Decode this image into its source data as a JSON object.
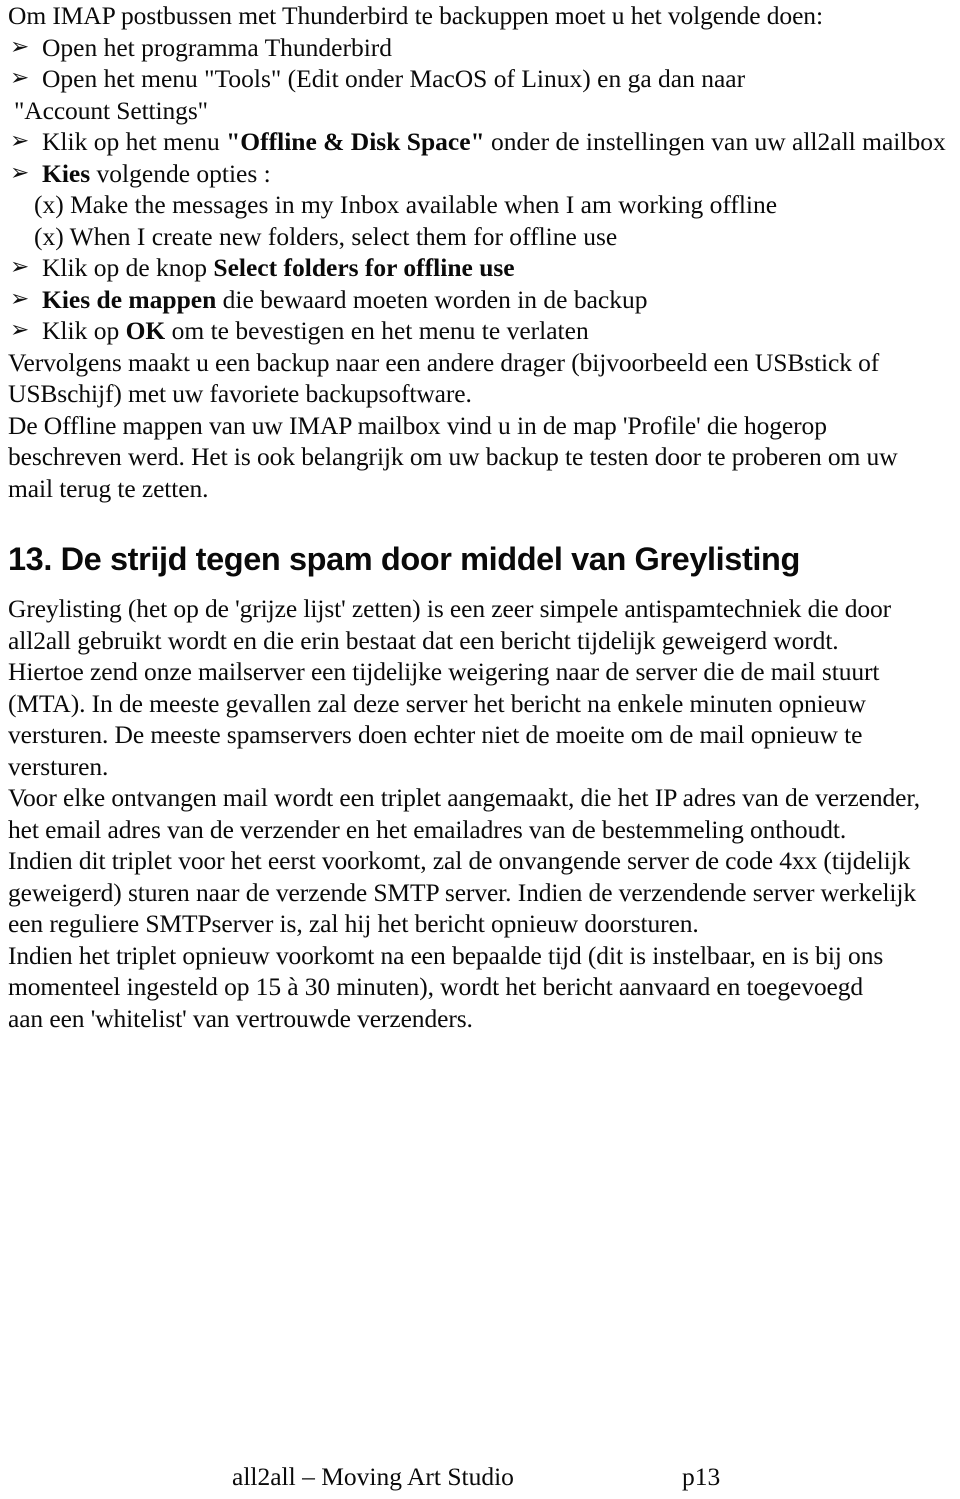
{
  "document": {
    "language": "nl",
    "page_label": "p13",
    "background_color": "#ffffff",
    "text_color": "#0a0a0a"
  },
  "intro": {
    "line": "Om IMAP postbussen met Thunderbird te backuppen moet u het volgende doen:"
  },
  "bullet_glyph": "➢",
  "steps": [
    {
      "id": "open-thunderbird",
      "text": "Open het programma Thunderbird"
    },
    {
      "id": "open-tools-menu",
      "text": "Open  het  menu  \"Tools\"  (Edit onder MacOS of Linux)  en ga dan  naar",
      "continuation": "\"Account Settings\""
    },
    {
      "id": "offline-disk-space",
      "prefix": "Klik op het menu ",
      "bold": "\"Offline & Disk Space\"",
      "suffix": " onder de instellingen van uw all2all mailbox"
    },
    {
      "id": "kies-opties",
      "bold": "Kies",
      "suffix": " volgende opties :"
    },
    {
      "id": "select-folders-button",
      "prefix": "Klik op de knop ",
      "bold": "Select folders for offline use"
    },
    {
      "id": "kies-de-mappen",
      "bold": "Kies de mappen",
      "suffix": " die bewaard moeten worden in de backup"
    },
    {
      "id": "klik-ok",
      "prefix": "Klik op ",
      "bold": "OK",
      "suffix": " om te bevestigen en het menu te verlaten"
    }
  ],
  "checkbox_options": [
    "(x) Make the messages in my Inbox available when I am working offline",
    "(x) When I create new folders, select them for offline use"
  ],
  "backup_note": {
    "lines": [
      "Vervolgens maakt u een backup naar een andere drager (bijvoorbeeld een USBstick of",
      "USBschijf) met  uw  favoriete  backupsoftware.",
      "De Offline mappen van uw IMAP mailbox vind u in de map 'Profile' die hogerop",
      "beschreven werd. Het is ook belangrijk om uw backup te testen door te proberen om uw",
      "mail  terug te zetten."
    ]
  },
  "section": {
    "number": "13.",
    "title": "De strijd tegen spam door middel van Greylisting",
    "heading_full": "13. De strijd tegen spam door middel van Greylisting"
  },
  "greylisting": {
    "paragraph_1": [
      "Greylisting (het op de 'grijze lijst' zetten) is een zeer simpele antispamtechniek die door",
      "all2all gebruikt wordt en die erin bestaat dat een bericht tijdelijk geweigerd wordt."
    ],
    "paragraph_2": [
      "Hiertoe zend onze mailserver een tijdelijke weigering  naar  de  server  die  de  mail   stuurt",
      "(MTA).  In de meeste gevallen zal deze server het bericht na enkele minuten  opnieuw",
      "versturen.  De meeste spamservers doen echter niet de moeite om de mail opnieuw te",
      "versturen."
    ],
    "paragraph_3": [
      "Voor elke ontvangen mail wordt een triplet aangemaakt, die het IP adres van de verzender,",
      "het email adres van de verzender en het emailadres van de bestemmeling onthoudt."
    ],
    "paragraph_4": [
      "Indien dit triplet voor het eerst voorkomt, zal de onvangende server de code 4xx (tijdelijk",
      "geweigerd) sturen naar de verzende SMTP server. Indien de verzendende server werkelijk",
      "een reguliere SMTPserver is, zal hij het  bericht  opnieuw  doorsturen."
    ],
    "paragraph_5": [
      "Indien het triplet opnieuw voorkomt na een bepaalde tijd (dit is  instelbaar, en is bij ons",
      "momenteel ingesteld op 15 à 30 minuten), wordt het bericht aanvaard en toegevoegd",
      "aan een 'whitelist' van vertrouwde verzenders."
    ]
  },
  "footer": {
    "title": "all2all – Moving Art Studio",
    "page": "p13"
  }
}
